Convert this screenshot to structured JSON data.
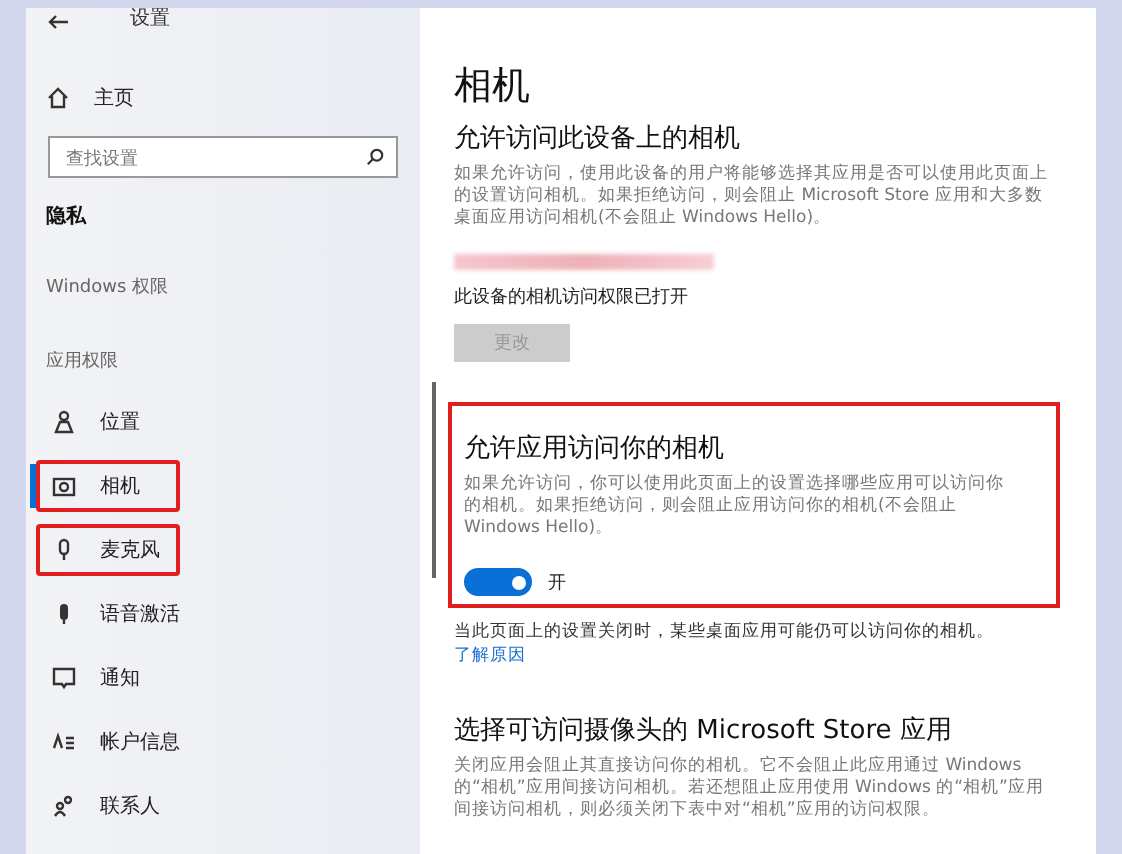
{
  "window": {
    "title": "设置"
  },
  "sidebar": {
    "home": "主页",
    "search": {
      "placeholder": "查找设置"
    },
    "section": "隐私",
    "groups": [
      {
        "label": "Windows 权限"
      },
      {
        "label": "应用权限",
        "items": [
          {
            "label": "位置",
            "selected": false,
            "annotated": false
          },
          {
            "label": "相机",
            "selected": true,
            "annotated": true
          },
          {
            "label": "麦克风",
            "selected": false,
            "annotated": true
          },
          {
            "label": "语音激活",
            "selected": false,
            "annotated": false
          },
          {
            "label": "通知",
            "selected": false,
            "annotated": false
          },
          {
            "label": "帐户信息",
            "selected": false,
            "annotated": false
          },
          {
            "label": "联系人",
            "selected": false,
            "annotated": false
          }
        ]
      }
    ]
  },
  "content": {
    "title": "相机",
    "device": {
      "heading": "允许访问此设备上的相机",
      "text": "如果允许访问，使用此设备的用户将能够选择其应用是否可以使用此页面上的设置访问相机。如果拒绝访问，则会阻止 Microsoft Store 应用和大多数桌面应用访问相机(不会阻止 Windows Hello)。",
      "status": "此设备的相机访问权限已打开",
      "button": {
        "label": "更改",
        "disabled": true
      }
    },
    "apps": {
      "heading": "允许应用访问你的相机",
      "text": "如果允许访问，你可以使用此页面上的设置选择哪些应用可以访问你的相机。如果拒绝访问，则会阻止应用访问你的相机(不会阻止 Windows Hello)。",
      "toggle": {
        "on": true,
        "label": "开"
      },
      "annotated": true
    },
    "note": {
      "text": "当此页面上的设置关闭时，某些桌面应用可能仍可以访问你的相机。",
      "link": "了解原因"
    },
    "store": {
      "heading": "选择可访问摄像头的 Microsoft Store 应用",
      "text": "关闭应用会阻止其直接访问你的相机。它不会阻止此应用通过 Windows 的“相机”应用间接访问相机。若还想阻止应用使用 Windows 的“相机”应用间接访问相机，则必须关闭下表中对“相机”应用的访问权限。"
    }
  }
}
